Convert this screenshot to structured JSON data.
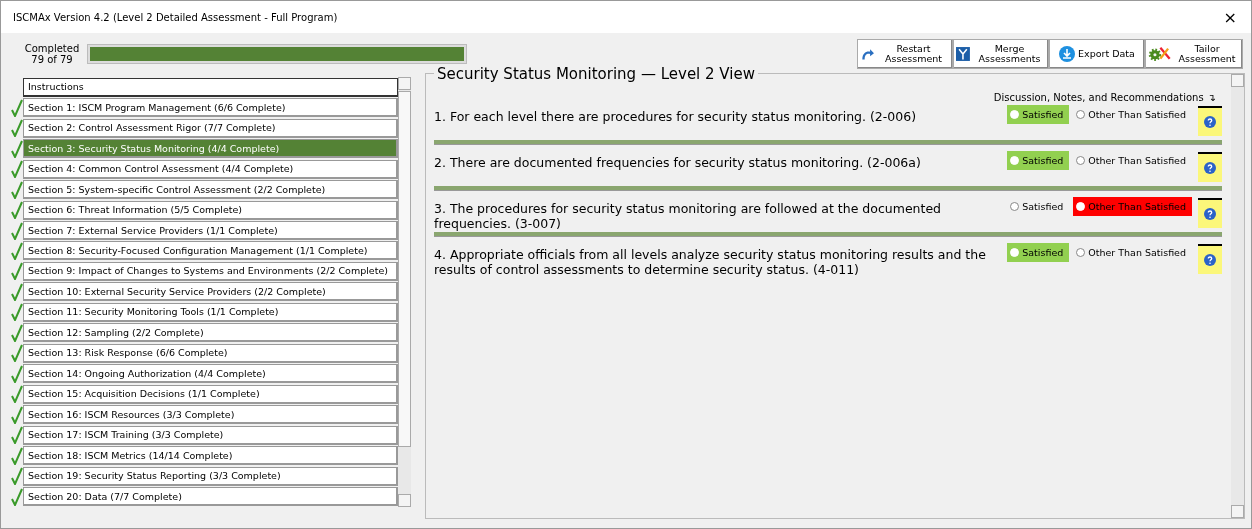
{
  "window": {
    "title": "ISCMAx Version 4.2 (Level 2 Detailed Assessment - Full Program)",
    "close": "×"
  },
  "progress": {
    "label": "Completed",
    "count": "79 of 79",
    "level": 1
  },
  "buttons": [
    {
      "kind": "restart",
      "label": "Restart Assessment"
    },
    {
      "kind": "merge",
      "label": "Merge Assessments"
    },
    {
      "kind": "export",
      "label": "Export Data"
    },
    {
      "kind": "tailor",
      "label": "Tailor Assessment"
    }
  ],
  "sections": [
    {
      "label": "Instructions",
      "checked": false,
      "selected": false
    },
    {
      "label": "Section 1: ISCM Program Management (6/6 Complete)",
      "checked": true,
      "selected": false
    },
    {
      "label": "Section 2: Control Assessment Rigor (7/7 Complete)",
      "checked": true,
      "selected": false
    },
    {
      "label": "Section 3: Security Status Monitoring (4/4 Complete)",
      "checked": true,
      "selected": true
    },
    {
      "label": "Section 4: Common Control Assessment (4/4 Complete)",
      "checked": true,
      "selected": false
    },
    {
      "label": "Section 5: System-specific Control Assessment (2/2 Complete)",
      "checked": true,
      "selected": false
    },
    {
      "label": "Section 6: Threat Information (5/5 Complete)",
      "checked": true,
      "selected": false
    },
    {
      "label": "Section 7: External Service Providers (1/1 Complete)",
      "checked": true,
      "selected": false
    },
    {
      "label": "Section 8: Security-Focused Configuration Management (1/1 Complete)",
      "checked": true,
      "selected": false
    },
    {
      "label": "Section 9: Impact of Changes to Systems and Environments (2/2 Complete)",
      "checked": true,
      "selected": false
    },
    {
      "label": "Section 10: External Security Service Providers (2/2 Complete)",
      "checked": true,
      "selected": false
    },
    {
      "label": "Section 11: Security Monitoring Tools (1/1 Complete)",
      "checked": true,
      "selected": false
    },
    {
      "label": "Section 12: Sampling (2/2 Complete)",
      "checked": true,
      "selected": false
    },
    {
      "label": "Section 13: Risk Response (6/6 Complete)",
      "checked": true,
      "selected": false
    },
    {
      "label": "Section 14: Ongoing Authorization (4/4 Complete)",
      "checked": true,
      "selected": false
    },
    {
      "label": "Section 15: Acquisition Decisions (1/1 Complete)",
      "checked": true,
      "selected": false
    },
    {
      "label": "Section 16: ISCM Resources (3/3 Complete)",
      "checked": true,
      "selected": false
    },
    {
      "label": "Section 17: ISCM Training (3/3 Complete)",
      "checked": true,
      "selected": false
    },
    {
      "label": "Section 18: ISCM Metrics (14/14 Complete)",
      "checked": true,
      "selected": false
    },
    {
      "label": "Section 19: Security Status Reporting (3/3 Complete)",
      "checked": true,
      "selected": false
    },
    {
      "label": "Section 20: Data (7/7 Complete)",
      "checked": true,
      "selected": false
    }
  ],
  "panel": {
    "title": "Security Status Monitoring — Level 2 View",
    "notes_heading": "Discussion, Notes, and Recommendations",
    "notes_arrow": "↴",
    "questions": [
      {
        "text": "1. For each level there are procedures for security status monitoring. (2-006)",
        "options": [
          {
            "kind": "satisfied",
            "label": "Satisfied",
            "selected": true
          },
          {
            "kind": "other",
            "label": "Other Than Satisfied",
            "selected": false
          }
        ]
      },
      {
        "text": "2. There are documented frequencies for security status monitoring. (2-006a)",
        "options": [
          {
            "kind": "satisfied",
            "label": "Satisfied",
            "selected": true
          },
          {
            "kind": "other",
            "label": "Other Than Satisfied",
            "selected": false
          }
        ]
      },
      {
        "text": "3. The procedures for security status monitoring are followed at the documented frequencies. (3-007)",
        "options": [
          {
            "kind": "satisfied",
            "label": "Satisfied",
            "selected": false
          },
          {
            "kind": "other",
            "label": "Other Than Satisfied",
            "selected": true
          }
        ]
      },
      {
        "text": "4. Appropriate officials from all levels analyze security status monitoring results and the results of control assessments to determine security status. (4-011)",
        "options": [
          {
            "kind": "satisfied",
            "label": "Satisfied",
            "selected": true
          },
          {
            "kind": "other",
            "label": "Other Than Satisfied",
            "selected": false
          }
        ]
      }
    ]
  }
}
